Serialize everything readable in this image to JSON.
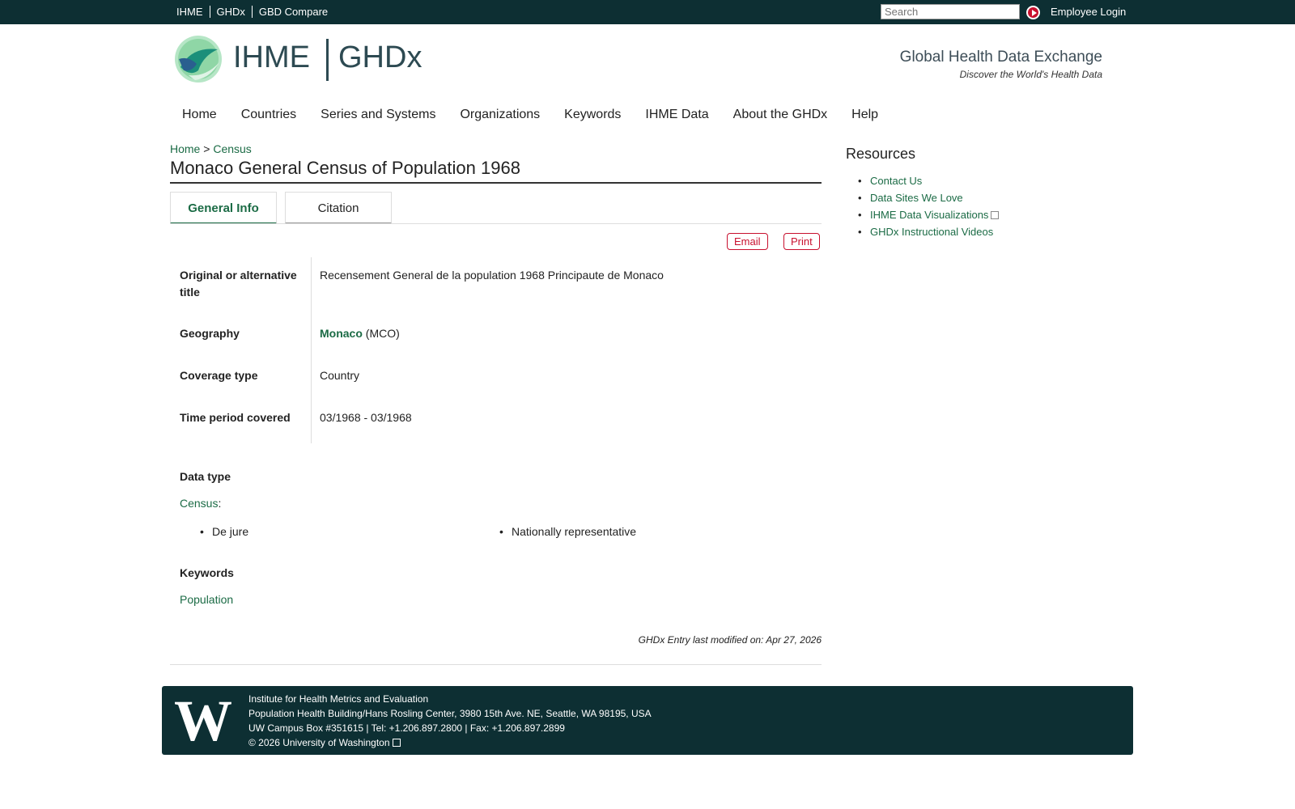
{
  "topbar": {
    "links": [
      "IHME",
      "GHDx",
      "GBD Compare"
    ],
    "search_placeholder": "Search",
    "employee_login": "Employee Login"
  },
  "header": {
    "logo_left": "IHME",
    "logo_right": "GHDx",
    "tagline": "Global Health Data Exchange",
    "subtagline": "Discover the World's Health Data"
  },
  "nav": [
    "Home",
    "Countries",
    "Series and Systems",
    "Organizations",
    "Keywords",
    "IHME Data",
    "About the GHDx",
    "Help"
  ],
  "breadcrumb": {
    "home": "Home",
    "sep": ">",
    "current": "Census"
  },
  "page_title": "Monaco General Census of Population 1968",
  "tabs": {
    "general": "General Info",
    "citation": "Citation"
  },
  "actions": {
    "email": "Email",
    "print": "Print"
  },
  "fields": {
    "alt_title_label": "Original or alternative title",
    "alt_title_value": "Recensement General de la population 1968 Principaute de Monaco",
    "geography_label": "Geography",
    "geography_link": "Monaco",
    "geography_code": "(MCO)",
    "coverage_label": "Coverage type",
    "coverage_value": "Country",
    "time_label": "Time period covered",
    "time_value": "03/1968 - 03/1968"
  },
  "data_type": {
    "label": "Data type",
    "link": "Census",
    "colon": ":",
    "items": [
      "De jure",
      "Nationally representative"
    ]
  },
  "keywords": {
    "label": "Keywords",
    "link": "Population"
  },
  "modified": "GHDx Entry last modified on: Apr 27, 2026",
  "resources": {
    "title": "Resources",
    "items": [
      "Contact Us",
      "Data Sites We Love",
      "IHME Data Visualizations",
      "GHDx Instructional Videos"
    ]
  },
  "footer": {
    "logo": "W",
    "line1": "Institute for Health Metrics and Evaluation",
    "line2": "Population Health Building/Hans Rosling Center, 3980 15th Ave. NE, Seattle, WA 98195, USA",
    "line3": "UW Campus Box #351615 | Tel: +1.206.897.2800 | Fax: +1.206.897.2899",
    "copyright": "© 2026",
    "uw_link": "University of Washington"
  }
}
